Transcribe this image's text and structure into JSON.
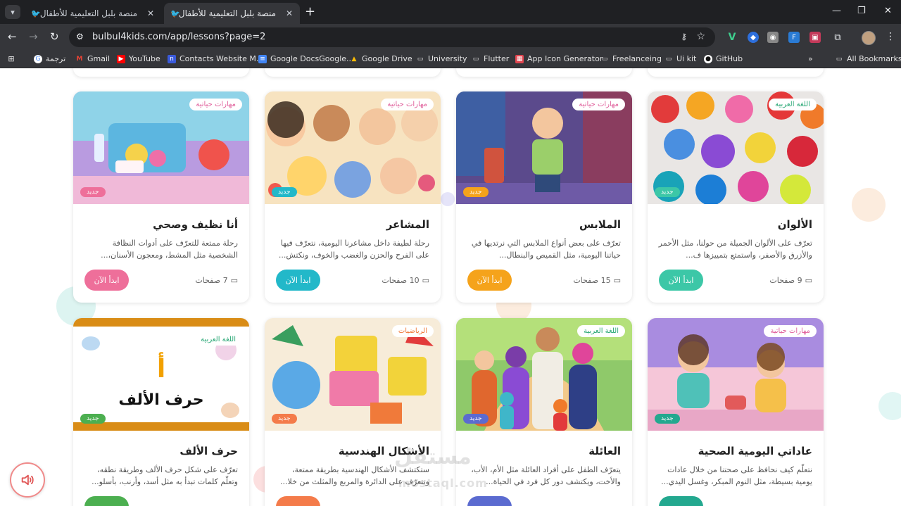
{
  "browser": {
    "tabs": [
      {
        "title": "منصة بلبل التعليمية للأطفال",
        "active": false
      },
      {
        "title": "منصة بلبل التعليمية للأطفال",
        "active": true
      }
    ],
    "url": "bulbul4kids.com/app/lessons?page=2",
    "bookmarks": [
      "ترجمة",
      "Gmail",
      "YouTube",
      "Contacts Website M...",
      "Google DocsGoogle...",
      "Google Drive",
      "University",
      "Flutter",
      "App Icon Generator",
      "Freelanceing",
      "Ui kit",
      "GitHub",
      "All Bookmarks"
    ]
  },
  "lessons": [
    {
      "title": "أنا نظيف وصحي",
      "category": "مهارات حياتية",
      "badge": "جديد",
      "desc": "رحلة ممتعة للتعرّف على أدوات النظافة الشخصية مثل المشط، ومعجون الأسنان،...",
      "pages": "7 صفحات",
      "start": "ابدأ الآن",
      "accent": "#ee6f9a"
    },
    {
      "title": "المشاعر",
      "category": "مهارات حياتية",
      "badge": "جديد",
      "desc": "رحلة لطيفة داخل مشاعرنا اليومية، نتعرّف فيها على الفرح والحزن والغضب والخوف، ونكتش...",
      "pages": "10 صفحات",
      "start": "ابدأ الآن",
      "accent": "#22b8c9"
    },
    {
      "title": "الملابس",
      "category": "مهارات حياتية",
      "badge": "جديد",
      "desc": "تعرّف على بعض أنواع الملابس التي نرتديها في حياتنا اليومية، مثل القميص والبنطال...",
      "pages": "15 صفحات",
      "start": "ابدأ الآن",
      "accent": "#f5a31b"
    },
    {
      "title": "الألوان",
      "category": "اللغة العربية",
      "badge": "جديد",
      "desc": "تعرّف على الألوان الجميلة من حولنا، مثل الأحمر والأزرق والأصفر، واستمتع بتمييزها ف...",
      "pages": "9 صفحات",
      "start": "ابدأ الآن",
      "accent": "#3cc7a7"
    },
    {
      "title": "حرف الألف",
      "category": "اللغة العربية",
      "badge": "جديد",
      "desc": "تعرّف على شكل حرف الألف وطريقة نطقه، وتعلّم كلمات تبدأ به مثل أسد، وأرنب، بأسلو...",
      "pages": "",
      "start": "",
      "accent": "#4caf50",
      "letter": "أ",
      "word": "حرف الألف"
    },
    {
      "title": "الأشكال الهندسية",
      "category": "الرياضيات",
      "badge": "جديد",
      "desc": "ستكتشف الأشكال الهندسية بطريقة ممتعة، وتتعرّف على الدائرة والمربع والمثلث من خلا...",
      "pages": "",
      "start": "",
      "accent": "#f47b4a"
    },
    {
      "title": "العائلة",
      "category": "اللغة العربية",
      "badge": "جديد",
      "desc": "يتعرّف الطفل على أفراد العائلة مثل الأم، الأب، والأخت، ويكتشف دور كل فرد في الحياة...",
      "pages": "",
      "start": "",
      "accent": "#5b6bd0"
    },
    {
      "title": "عاداتي اليومية الصحية",
      "category": "مهارات حياتية",
      "badge": "جديد",
      "desc": "نتعلّم كيف نحافظ على صحتنا من خلال عادات يومية بسيطة، مثل النوم المبكر، وغسل اليدي...",
      "pages": "",
      "start": "",
      "accent": "#23a88f"
    }
  ],
  "watermark": {
    "ar": "مستقل",
    "en": "mostaql.com"
  },
  "icons": {
    "audio": "speaker-icon",
    "pages": "book-icon"
  }
}
